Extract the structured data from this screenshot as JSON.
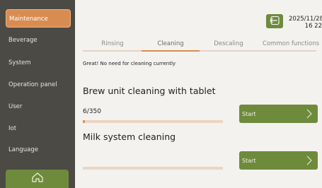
{
  "sidebar": {
    "items": [
      {
        "label": "Maintenance",
        "active": true
      },
      {
        "label": "Beverage",
        "active": false
      },
      {
        "label": "System",
        "active": false
      },
      {
        "label": "Operation panel",
        "active": false
      },
      {
        "label": "User",
        "active": false
      },
      {
        "label": "Iot",
        "active": false
      },
      {
        "label": "Language",
        "active": false
      }
    ],
    "home_icon": "home-icon"
  },
  "header": {
    "back_icon": "back-arrow-icon",
    "date": "2025/11/28",
    "time": "16 22"
  },
  "tabs": [
    {
      "label": "Rinsing",
      "active": false
    },
    {
      "label": "Cleaning",
      "active": true
    },
    {
      "label": "Descaling",
      "active": false
    },
    {
      "label": "Common functions",
      "active": false
    }
  ],
  "status_message": "Great! No need for cleaning currently",
  "brew_unit": {
    "title": "Brew unit cleaning with tablet",
    "count": "6/350",
    "progress": 0.017,
    "start_label": "Start"
  },
  "milk_system": {
    "title": "Milk system cleaning",
    "progress": 0,
    "start_label": "Start"
  },
  "colors": {
    "sidebar_bg": "#4b4a45",
    "accent_orange": "#d98c52",
    "button_green": "#6e8b3c",
    "page_bg": "#f3f2ef"
  }
}
